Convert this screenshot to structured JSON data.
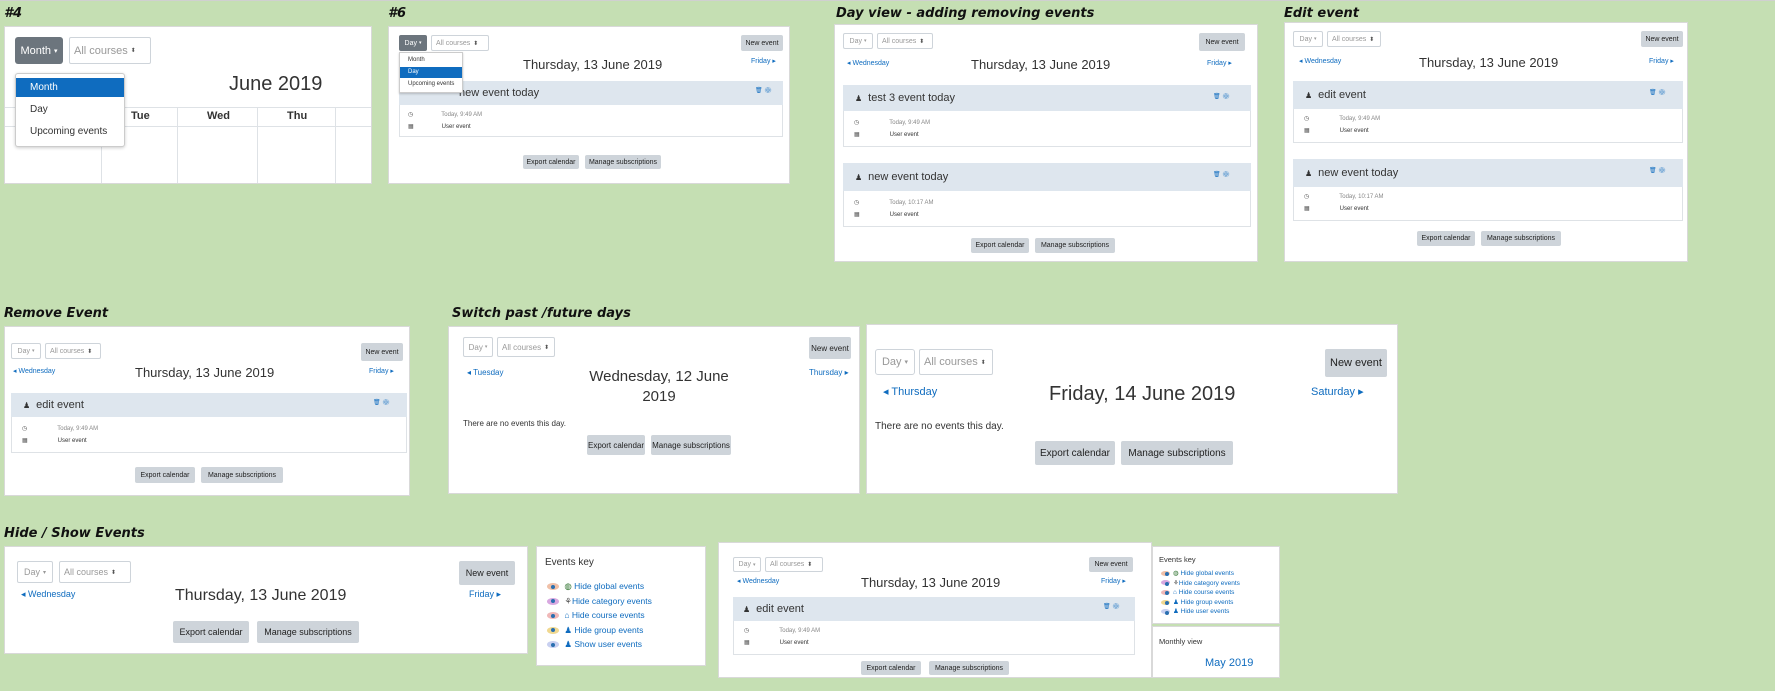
{
  "sections": {
    "s4": "#4",
    "s6": "#6",
    "dayview": "Day view - adding removing events",
    "edit": "Edit event",
    "remove": "Remove Event",
    "switch": "Switch past /future days",
    "hideshow": "Hide / Show Events"
  },
  "common": {
    "day": "Day",
    "month": "Month",
    "all_courses": "All courses",
    "new_event": "New event",
    "export": "Export calendar",
    "manage": "Manage subscriptions",
    "user_event": "User event",
    "no_events": "There are no events this day.",
    "caret": "▾",
    "updown": "⬍"
  },
  "p1": {
    "title": "June 2019",
    "dropdown": [
      "Month",
      "Day",
      "Upcoming events"
    ],
    "weekdays": [
      "Tue",
      "Wed",
      "Thu"
    ]
  },
  "p2": {
    "dropdown": [
      "Month",
      "Day",
      "Upcoming events"
    ],
    "date": "Thursday, 13 June 2019",
    "next": "Friday",
    "event_title": "new event today",
    "time": "Today, 9:49 AM"
  },
  "p3": {
    "prev": "Wednesday",
    "next": "Friday",
    "date": "Thursday, 13 June 2019",
    "events": [
      {
        "title": "test 3 event today",
        "time": "Today, 9:49 AM"
      },
      {
        "title": "new event today",
        "time": "Today, 10:17 AM"
      }
    ]
  },
  "p4": {
    "prev": "Wednesday",
    "next": "Friday",
    "date": "Thursday, 13 June 2019",
    "events": [
      {
        "title": "edit event",
        "time": "Today, 9:49 AM"
      },
      {
        "title": "new event today",
        "time": "Today, 10:17 AM"
      }
    ]
  },
  "p5": {
    "prev": "Wednesday",
    "next": "Friday",
    "date": "Thursday, 13 June 2019",
    "event_title": "edit event",
    "time": "Today, 9:49 AM"
  },
  "p6": {
    "prev": "Tuesday",
    "next": "Thursday",
    "date_line1": "Wednesday, 12 June",
    "date_line2": "2019"
  },
  "p7": {
    "prev": "Thursday",
    "next": "Saturday",
    "date": "Friday, 14 June 2019"
  },
  "p8": {
    "prev": "Wednesday",
    "next": "Friday",
    "date": "Thursday, 13 June 2019",
    "key_title": "Events key",
    "key_items": [
      "Hide global events",
      "Hide category events",
      "Hide course events",
      "Hide group events",
      "Show user events"
    ]
  },
  "p9": {
    "prev": "Wednesday",
    "next": "Friday",
    "date": "Thursday, 13 June 2019",
    "event_title": "edit event",
    "time": "Today, 9:49 AM",
    "key_title": "Events key",
    "key_items": [
      "Hide global events",
      "Hide category events",
      "Hide course events",
      "Hide group events",
      "Hide user events"
    ],
    "monthly_title": "Monthly view",
    "monthly_month": "May 2019"
  },
  "colors": {
    "background": "#c5dfb3",
    "link": "#0f6cbf",
    "button_gray": "#ced4da",
    "active_blue": "#0f6cbf",
    "event_header": "#dee6ee"
  },
  "icons": [
    "clock-icon",
    "calendar-icon",
    "user-icon",
    "trash-icon",
    "gear-icon",
    "eye-icon",
    "globe-icon",
    "category-icon",
    "course-icon",
    "group-icon"
  ]
}
